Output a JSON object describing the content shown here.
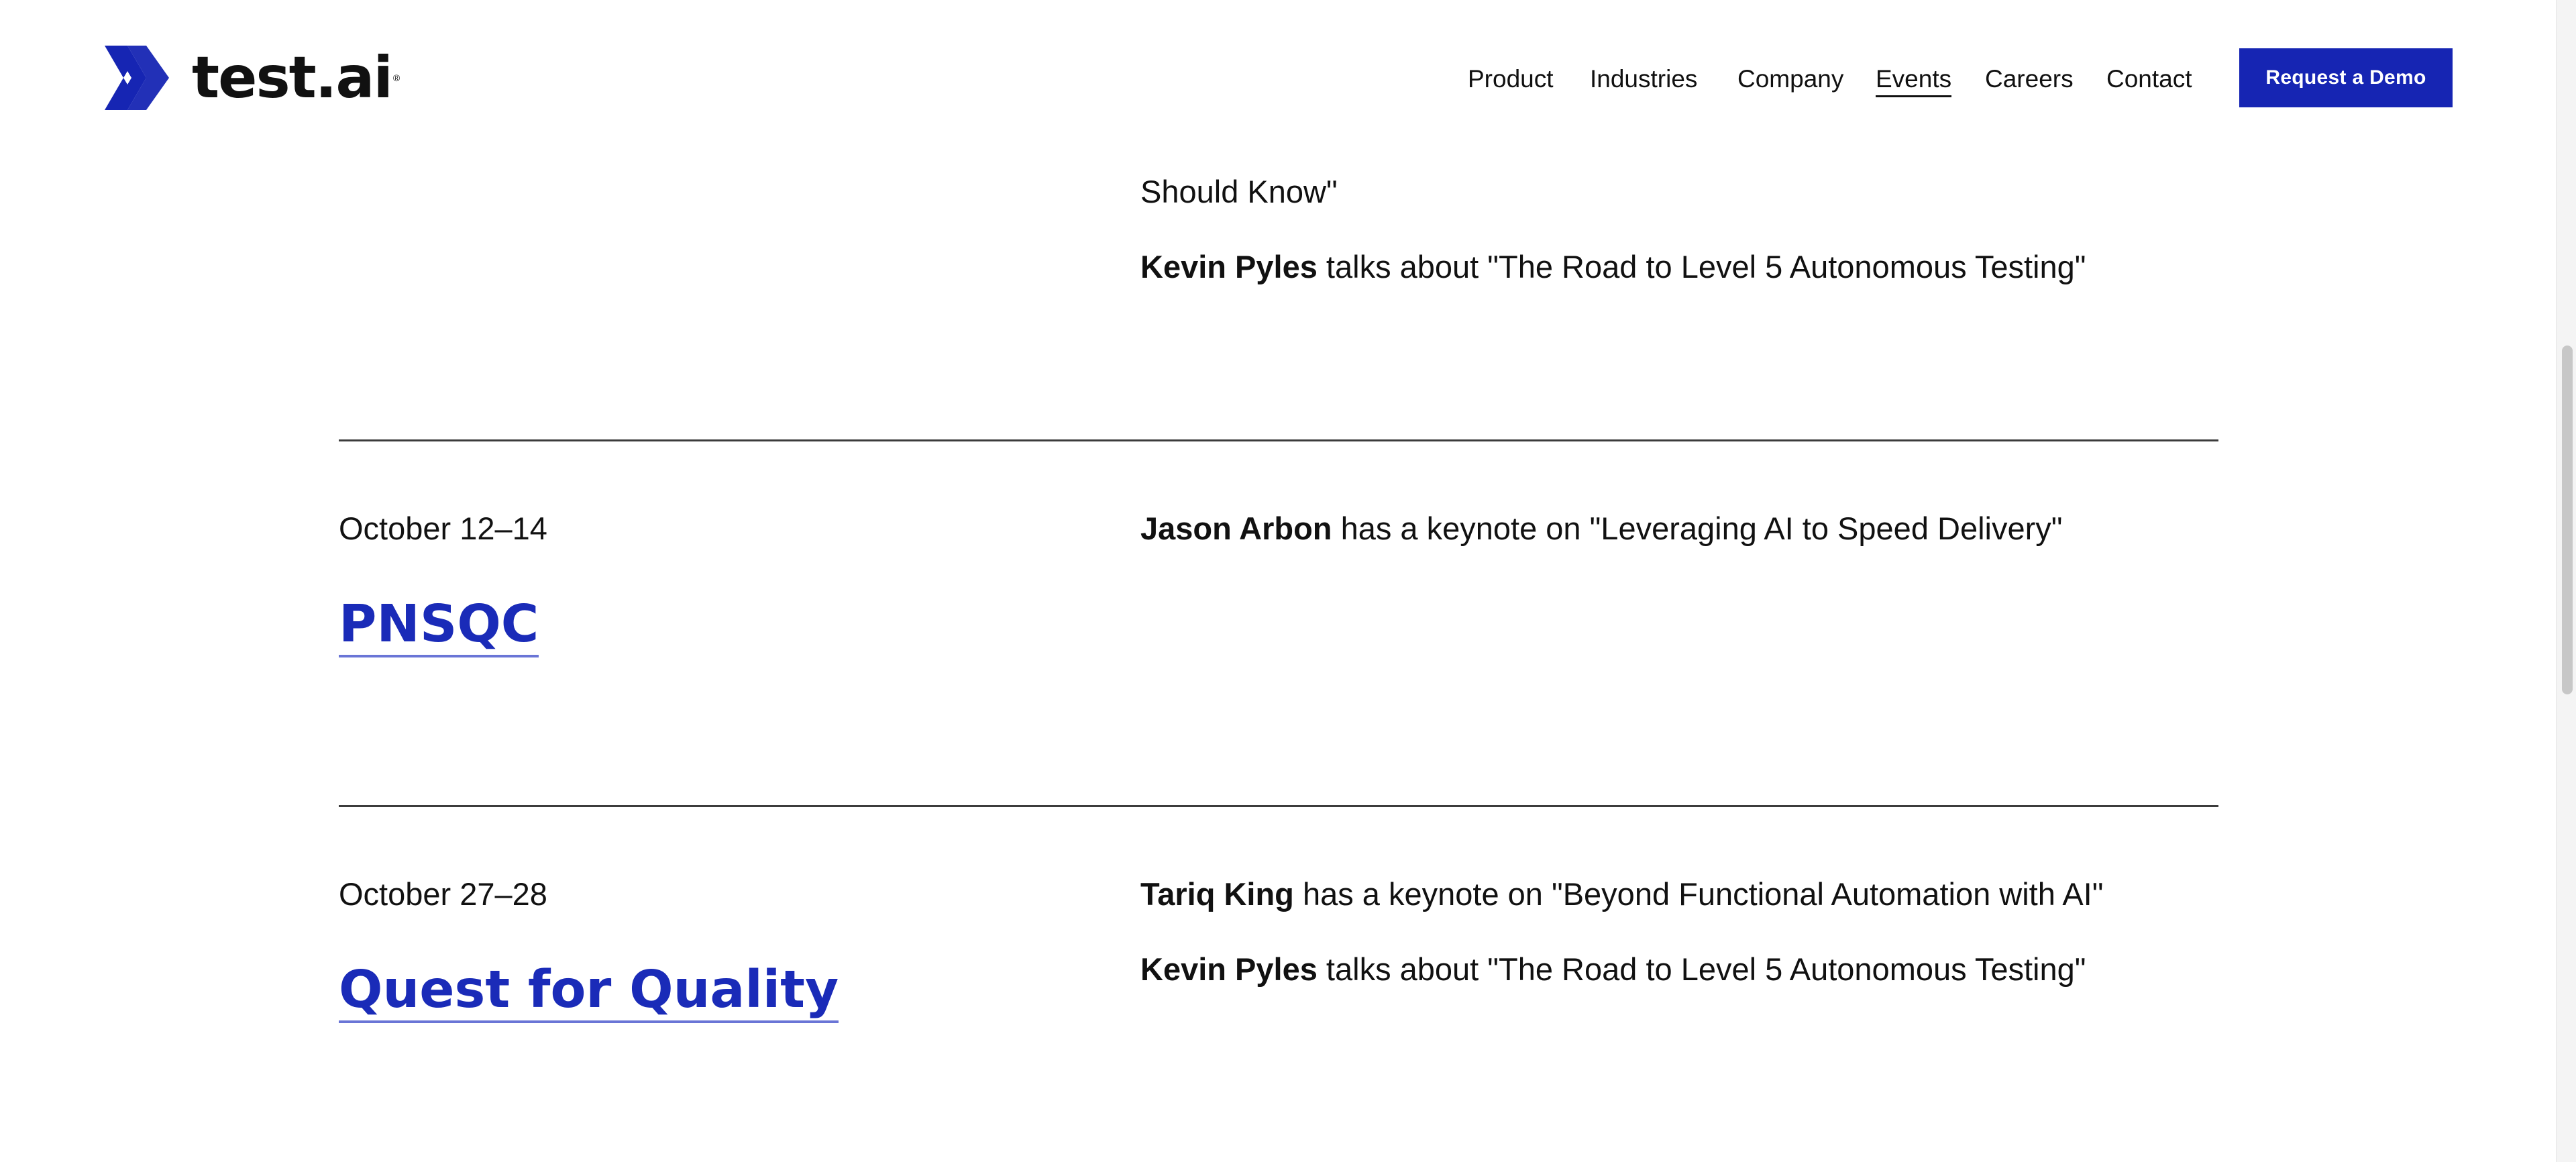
{
  "brand": {
    "name": "test.ai",
    "reg_mark": "®",
    "accent_color": "#1625b3"
  },
  "nav": {
    "items": [
      {
        "label": "Product"
      },
      {
        "label": "Industries"
      },
      {
        "label": "Company"
      },
      {
        "label": "Events",
        "active": true
      },
      {
        "label": "Careers"
      },
      {
        "label": "Contact"
      }
    ],
    "cta_label": "Request a Demo"
  },
  "events": {
    "prev": {
      "talk_tail": "Should Know\"",
      "talk2_speaker": "Kevin Pyles",
      "talk2_text": " talks about \"The Road to Level 5 Autonomous Testing\""
    },
    "pnsqc": {
      "date": "October 12–14",
      "title": "PNSQC",
      "talk1_speaker": "Jason Arbon",
      "talk1_text": " has a keynote on \"Leveraging AI to Speed Delivery\""
    },
    "quest": {
      "date": "October 27–28",
      "title": "Quest for Quality",
      "talk1_speaker": "Tariq King",
      "talk1_text": " has a keynote on \"Beyond Functional Automation with AI\"",
      "talk2_speaker": "Kevin Pyles",
      "talk2_text": " talks about \"The Road to Level 5 Autonomous Testing\""
    }
  }
}
